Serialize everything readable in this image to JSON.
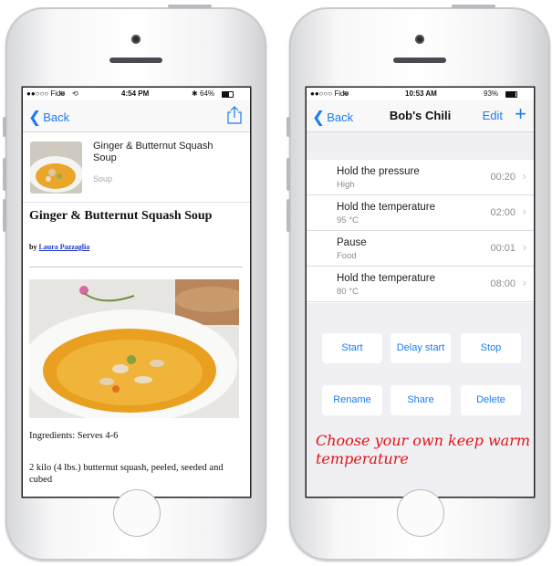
{
  "left_phone": {
    "status": {
      "carrier": "●●○○○ Fido",
      "time": "4:54 PM",
      "battery": "64%",
      "battery_level": 0.64
    },
    "nav": {
      "back_label": "Back",
      "share_icon": "share-icon"
    },
    "recipe_card": {
      "title": "Ginger & Butternut Squash Soup",
      "category": "Soup"
    },
    "recipe_title": "Ginger & Butternut Squash Soup",
    "by_label": "by",
    "author": "Laura Pazzaglia",
    "ingredients_heading": "Ingredients: Serves 4-6",
    "ingredient_1": "2 kilo (4 lbs.) butternut squash, peeled, seeded and cubed"
  },
  "right_phone": {
    "status": {
      "carrier": "●●○○○ Fido",
      "time": "10:53 AM",
      "battery": "93%",
      "battery_level": 0.93
    },
    "nav": {
      "back_label": "Back",
      "title": "Bob's Chili",
      "edit_label": "Edit",
      "add_icon": "plus-icon"
    },
    "steps": [
      {
        "name": "Hold the pressure",
        "detail": "High",
        "time": "00:20"
      },
      {
        "name": "Hold the temperature",
        "detail": "95 °C",
        "time": "02:00"
      },
      {
        "name": "Pause",
        "detail": "Food",
        "time": "00:01"
      },
      {
        "name": "Hold the temperature",
        "detail": "80 °C",
        "time": "08:00"
      }
    ],
    "buttons": {
      "start": "Start",
      "delay_start": "Delay start",
      "stop": "Stop",
      "rename": "Rename",
      "share": "Share",
      "delete": "Delete"
    },
    "promo_text": "Choose your own keep warm temperature"
  },
  "colors": {
    "accent": "#1a7cf6",
    "promo": "#e21414",
    "grouped_bg": "#efeff4"
  }
}
